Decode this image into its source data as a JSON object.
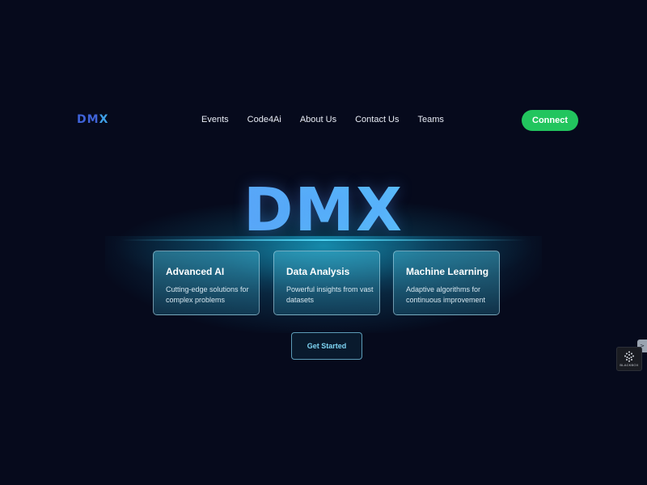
{
  "brand": {
    "logo_prefix": "DM",
    "logo_suffix": "X"
  },
  "nav": {
    "links": [
      "Events",
      "Code4Ai",
      "About Us",
      "Contact Us",
      "Teams"
    ],
    "connect_label": "Connect"
  },
  "hero": {
    "title": "DMX",
    "cards": [
      {
        "title": "Advanced AI",
        "description": "Cutting-edge solutions for complex problems"
      },
      {
        "title": "Data Analysis",
        "description": "Powerful insights from vast datasets"
      },
      {
        "title": "Machine Learning",
        "description": "Adaptive algorithms for continuous improvement"
      }
    ],
    "cta_label": "Get Started"
  },
  "side_widget": {
    "tab_glyph": ">",
    "label": "BLACKBOX"
  },
  "colors": {
    "background": "#060a1c",
    "connect_button": "#22c55e",
    "logo": "#3f63d8",
    "accent_cyan": "#58b8f8"
  }
}
